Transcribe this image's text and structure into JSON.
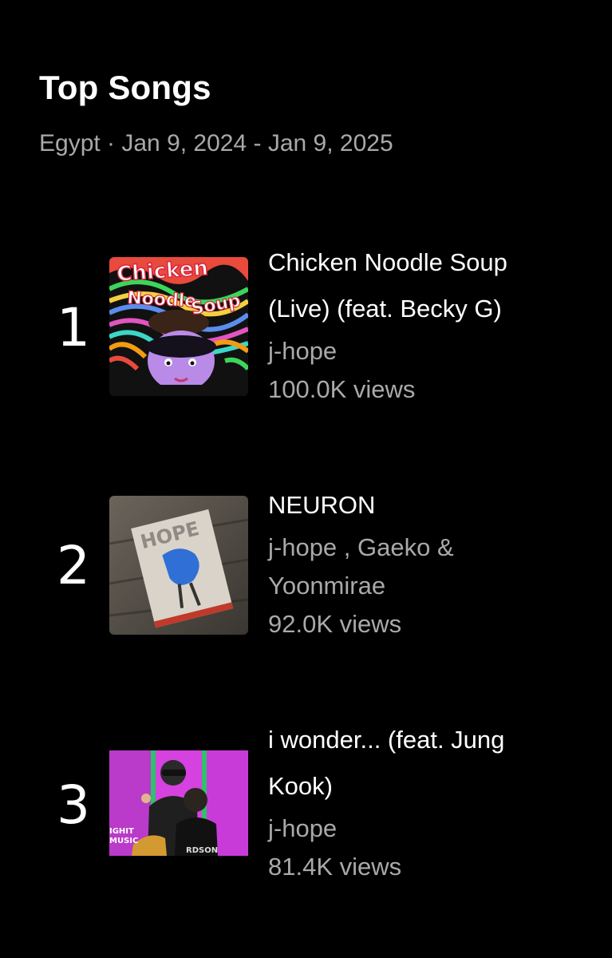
{
  "header": {
    "title": "Top Songs",
    "subtitle": "Egypt · Jan 9, 2024 - Jan 9, 2025"
  },
  "songs": [
    {
      "rank": "1",
      "title_line1": "Chicken Noodle Soup",
      "title_line2": "(Live) (feat. Becky G)",
      "artist_line1": "j-hope",
      "artist_line2": "",
      "views": "100.0K views",
      "thumb_text_1": "Chicken",
      "thumb_text_2": "Noodle",
      "thumb_text_3": "Soup"
    },
    {
      "rank": "2",
      "title_line1": "NEURON",
      "title_line2": "",
      "artist_line1": "j-hope , Gaeko &",
      "artist_line2": "Yoonmirae",
      "views": "92.0K views",
      "thumb_text_1": "HOPE"
    },
    {
      "rank": "3",
      "title_line1": "i wonder... (feat. Jung",
      "title_line2": "Kook)",
      "artist_line1": "j-hope",
      "artist_line2": "",
      "views": "81.4K views",
      "thumb_text_1": "IGHIT",
      "thumb_text_2": "MUSIC",
      "thumb_text_3": "RDSON"
    }
  ],
  "colors": {
    "background": "#000000",
    "primary_text": "#ffffff",
    "secondary_text": "#a9a9a9"
  }
}
